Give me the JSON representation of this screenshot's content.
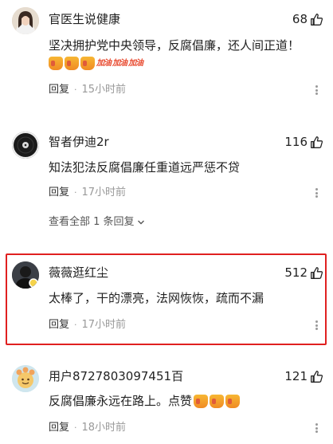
{
  "comments": [
    {
      "name": "官医生说健康",
      "likes": "68",
      "text": "坚决拥护党中央领导，反腐倡廉，还人间正道！",
      "emoji_text": "加油",
      "reply": "回复",
      "time": "15小时前"
    },
    {
      "name": "智者伊迪2r",
      "likes": "116",
      "text": "知法犯法反腐倡廉任重道远严惩不贷",
      "reply": "回复",
      "time": "17小时前",
      "view_replies": "查看全部 1 条回复"
    },
    {
      "name": "薇薇逛红尘",
      "likes": "512",
      "text": "太棒了，干的漂亮，法网恢恢，疏而不漏",
      "reply": "回复",
      "time": "17小时前"
    },
    {
      "name": "用户8727803097451百",
      "likes": "121",
      "text": "反腐倡廉永远在路上。点赞",
      "reply": "回复",
      "time": "18小时前"
    }
  ],
  "colors": {
    "highlight": "#e02020",
    "meta_gray": "#999999"
  },
  "icons": [
    "thumbs-up-icon",
    "more-dots-icon",
    "chevron-down-icon"
  ]
}
